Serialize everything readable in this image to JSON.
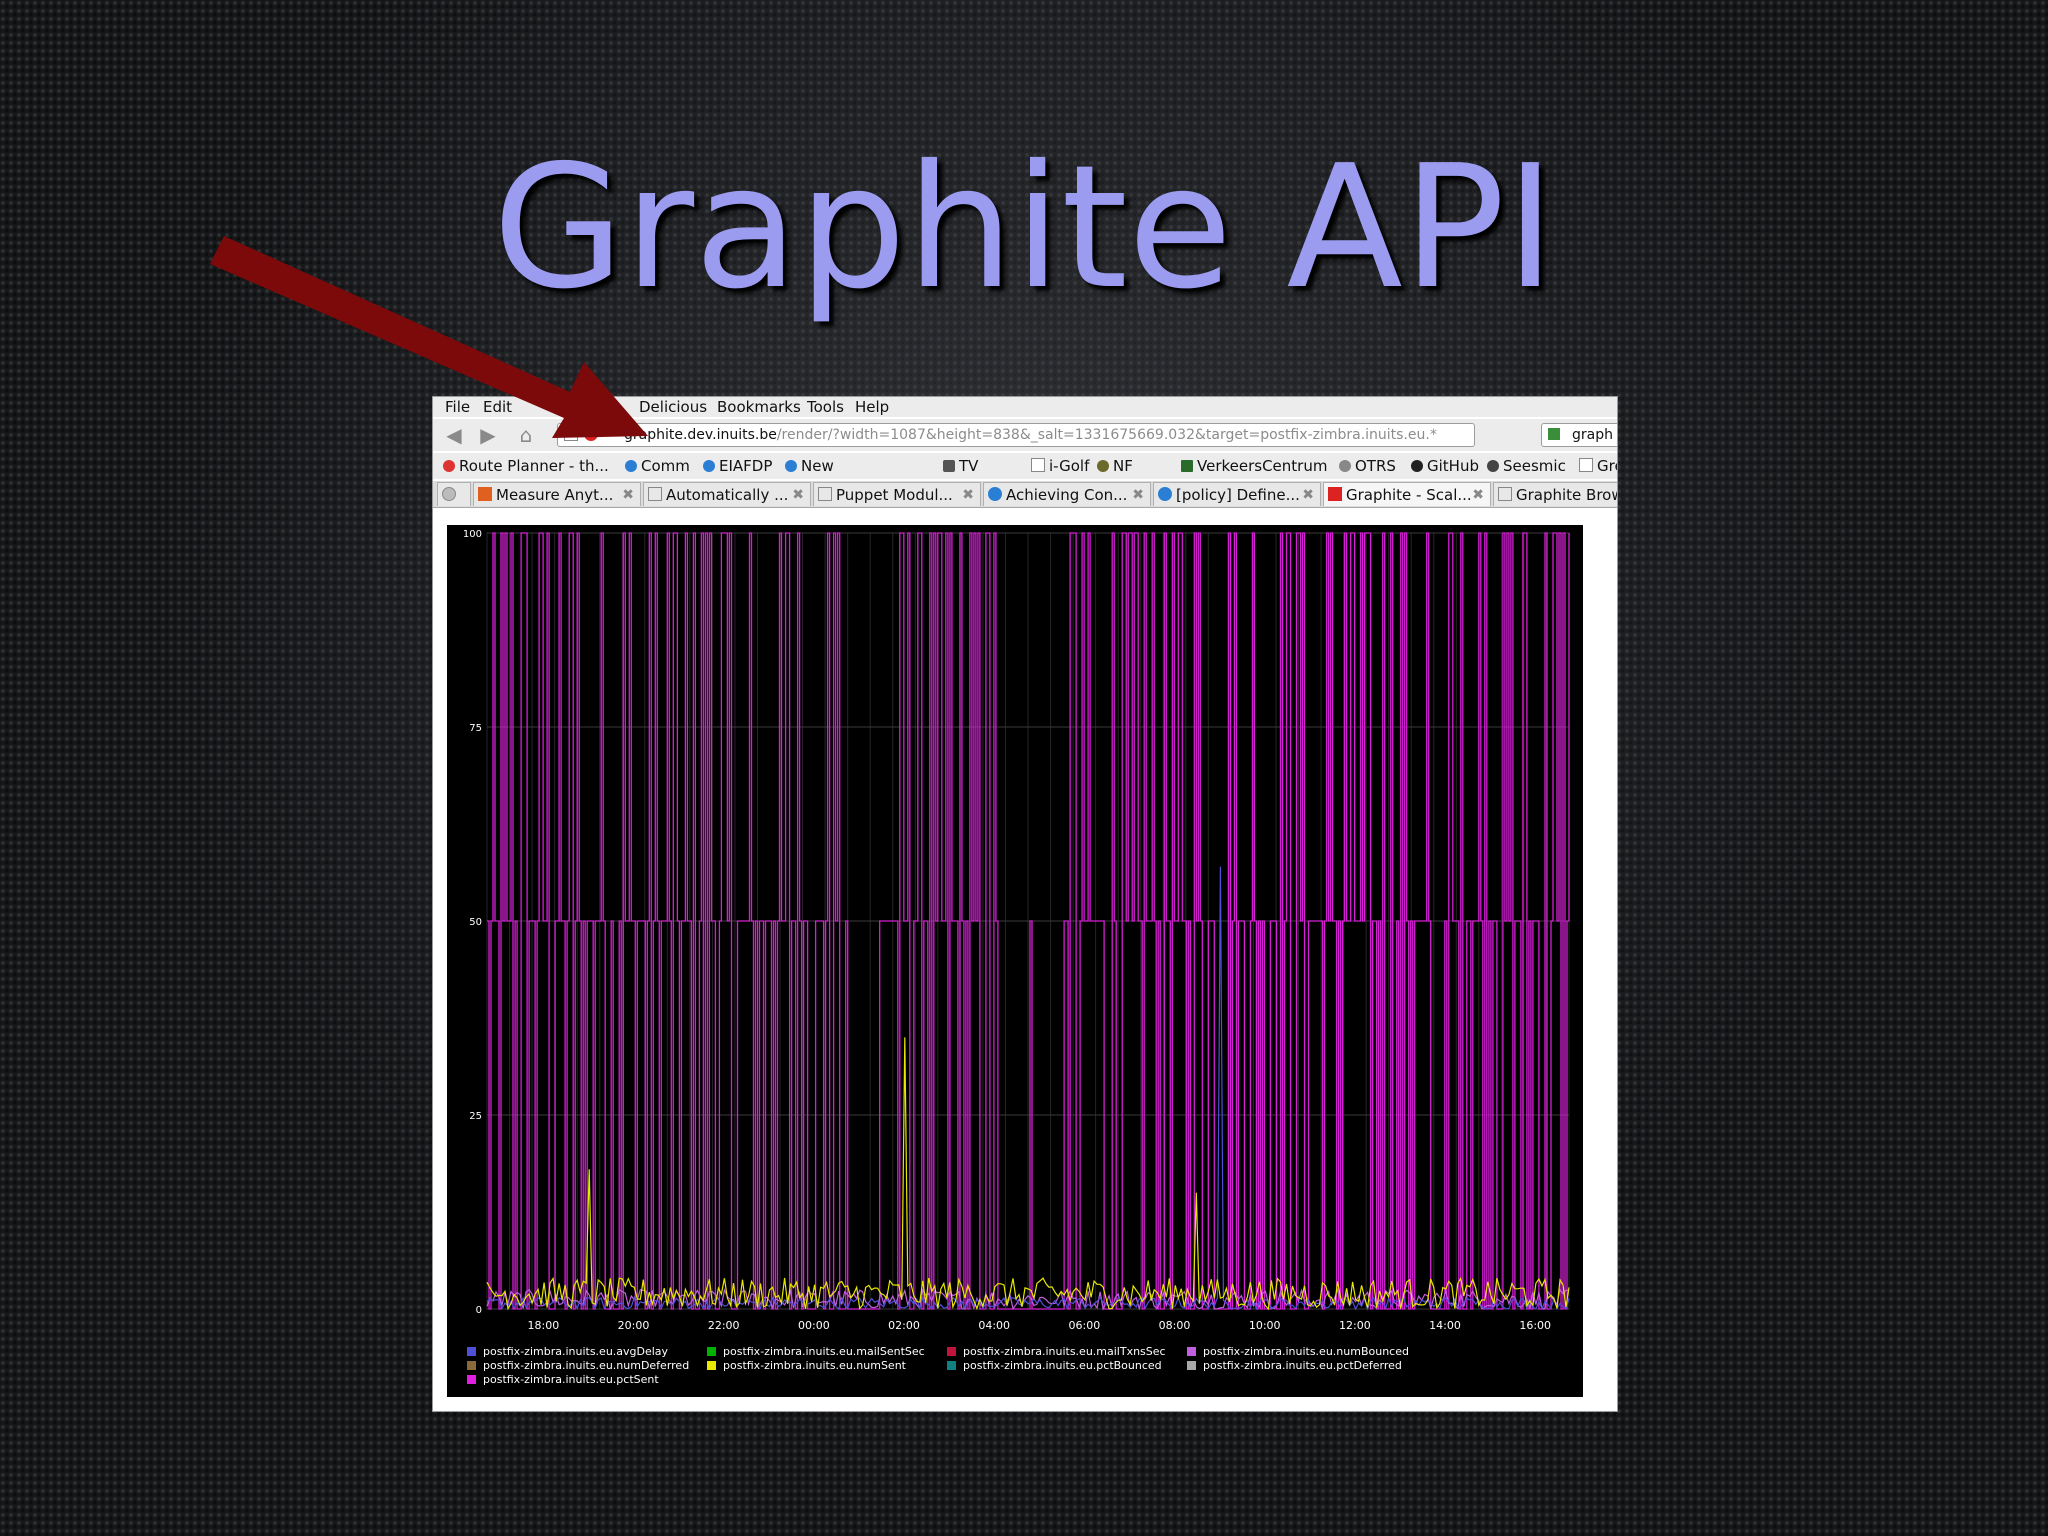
{
  "slide": {
    "title": "Graphite API"
  },
  "browser": {
    "menu": [
      "File",
      "Edit",
      "Delicious",
      "Bookmarks",
      "Tools",
      "Help"
    ],
    "url_host": "graphite.dev.inuits.be",
    "url_path": "/render/?width=1087&height=838&_salt=1331675669.032&target=postfix-zimbra.inuits.eu.*",
    "search_text": "graph",
    "bookmarks": [
      "Route Planner - th...",
      "Comm",
      "EIAFDP",
      "New",
      "TV",
      "i-Golf",
      "NF",
      "VerkeersCentrum",
      "OTRS",
      "GitHub",
      "Seesmic",
      "Gre"
    ],
    "tabs": [
      "Measure Anyt...",
      "Automatically ...",
      "Puppet Modul...",
      "Achieving Con...",
      "[policy] Define...",
      "Graphite - Scal...",
      "Graphite Brow"
    ]
  },
  "chart_data": {
    "type": "line",
    "ylim": [
      0,
      100
    ],
    "y_ticks": [
      "0",
      "25",
      "50",
      "75",
      "100"
    ],
    "x_ticks": [
      "18:00",
      "20:00",
      "22:00",
      "00:00",
      "02:00",
      "04:00",
      "06:00",
      "08:00",
      "10:00",
      "12:00",
      "14:00",
      "16:00"
    ],
    "grid": true,
    "legend_position": "bottom",
    "series": [
      {
        "name": "postfix-zimbra.inuits.eu.avgDelay",
        "color": "#4f4fd8"
      },
      {
        "name": "postfix-zimbra.inuits.eu.mailSentSec",
        "color": "#00b200"
      },
      {
        "name": "postfix-zimbra.inuits.eu.mailTxnsSec",
        "color": "#c0143c"
      },
      {
        "name": "postfix-zimbra.inuits.eu.numBounced",
        "color": "#c060e0"
      },
      {
        "name": "postfix-zimbra.inuits.eu.numDeferred",
        "color": "#8a6a3a"
      },
      {
        "name": "postfix-zimbra.inuits.eu.numSent",
        "color": "#e8e800"
      },
      {
        "name": "postfix-zimbra.inuits.eu.pctBounced",
        "color": "#108080"
      },
      {
        "name": "postfix-zimbra.inuits.eu.pctDeferred",
        "color": "#a8a8a8"
      },
      {
        "name": "postfix-zimbra.inuits.eu.pctSent",
        "color": "#e020e0"
      }
    ],
    "pctSent_levels": [
      0,
      50,
      100
    ],
    "numSent_peaks": [
      {
        "x": "19:00",
        "y": 18
      },
      {
        "x": "02:00",
        "y": 35
      },
      {
        "x": "08:30",
        "y": 15
      }
    ],
    "avgDelay_peak": {
      "x": "09:00",
      "y": 57
    }
  }
}
